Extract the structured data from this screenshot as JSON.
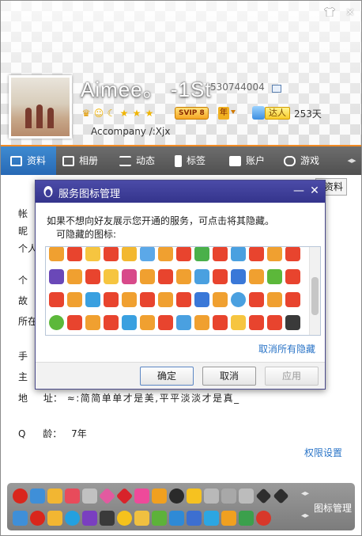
{
  "window": {
    "skin_icon": "shirt-icon",
    "close_icon": "close-icon"
  },
  "profile": {
    "nickname": "Aimee。 -1St",
    "qq_number": "530744004",
    "vip_label": "SVIP 8",
    "year_label": "年",
    "daren_label": "达人",
    "days": "253天",
    "signature": "Accompany /:Xjx"
  },
  "tabs": [
    {
      "label": "资料",
      "icon": "profile-card-icon"
    },
    {
      "label": "相册",
      "icon": "photo-icon"
    },
    {
      "label": "动态",
      "icon": "list-icon"
    },
    {
      "label": "标签",
      "icon": "bookmark-icon"
    },
    {
      "label": "账户",
      "icon": "briefcase-icon"
    },
    {
      "label": "游戏",
      "icon": "gamepad-icon"
    }
  ],
  "content": {
    "edit_button": "资料",
    "rows": [
      {
        "label": "帐"
      },
      {
        "label": "昵"
      },
      {
        "label": "个人"
      },
      {
        "label": "个"
      },
      {
        "label": "故"
      },
      {
        "label": "所在"
      },
      {
        "label": "手"
      },
      {
        "label": "主"
      },
      {
        "label": "地",
        "colon": "址：",
        "value": "≈:简简单单才是美,平平淡淡才是真_"
      },
      {
        "label": "Q",
        "colon": "龄：",
        "value": "7年"
      }
    ],
    "permission_link": "权限设置"
  },
  "tray": {
    "manage_label": "图标管理"
  },
  "dialog": {
    "title": "服务图标管理",
    "description": "如果不想向好友展示您开通的服务，可点击将其隐藏。",
    "hideable_label": "可隐藏的图标:",
    "unhide_all": "取消所有隐藏",
    "ok": "确定",
    "cancel": "取消",
    "apply": "应用"
  },
  "colors": {
    "accent": "#f08a24",
    "tab_active": "#2f78c3",
    "dialog_title": "#3c3c98",
    "link": "#2a74c7"
  }
}
